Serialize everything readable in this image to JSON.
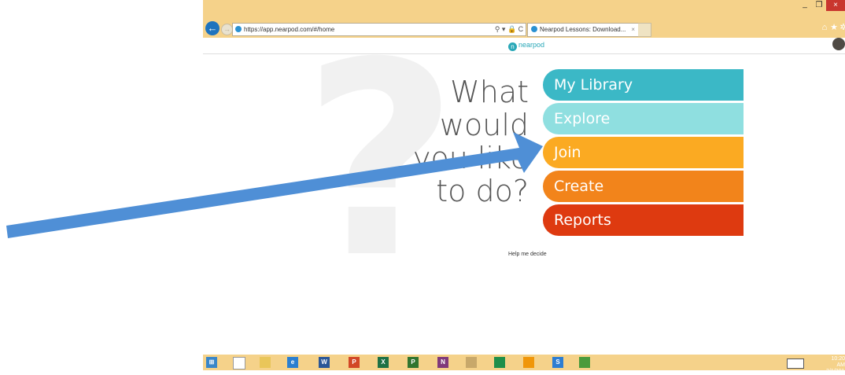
{
  "browser": {
    "url": "https://app.nearpod.com/#/home",
    "tab_title": "Nearpod Lessons: Download...",
    "tab_close": "×",
    "toolbar_glyphs": "⚲ ▾ 🔒 C",
    "back_icon": "arrow-left",
    "window": {
      "min": "_",
      "max": "❐",
      "close": "×"
    }
  },
  "site": {
    "logo_text": "nearpod"
  },
  "question": [
    "What",
    "would",
    "you like",
    "to do?"
  ],
  "menu": [
    {
      "label": "My Library",
      "color": "#3bb8c6"
    },
    {
      "label": "Explore",
      "color": "#8fdfe0"
    },
    {
      "label": "Join",
      "color": "#fbaa22"
    },
    {
      "label": "Create",
      "color": "#f2841b"
    },
    {
      "label": "Reports",
      "color": "#de3a10"
    }
  ],
  "help_link": "Help me decide",
  "annotation": {
    "color": "#4f8fd6"
  },
  "taskbar": {
    "apps": [
      {
        "name": "start",
        "color": "#3a86c8",
        "glyph": "⊞"
      },
      {
        "name": "file",
        "color": "#ffffff",
        "glyph": ""
      },
      {
        "name": "file-explorer",
        "color": "#e9c65a",
        "glyph": ""
      },
      {
        "name": "internet-explorer",
        "color": "#2b7fd0",
        "glyph": "e"
      },
      {
        "name": "word",
        "color": "#2b5797",
        "glyph": "W"
      },
      {
        "name": "powerpoint",
        "color": "#d24726",
        "glyph": "P"
      },
      {
        "name": "excel",
        "color": "#1e7145",
        "glyph": "X"
      },
      {
        "name": "project",
        "color": "#31752f",
        "glyph": "P"
      },
      {
        "name": "onenote",
        "color": "#80397b",
        "glyph": "N"
      },
      {
        "name": "paint",
        "color": "#c8a86a",
        "glyph": ""
      },
      {
        "name": "app-green",
        "color": "#1f8f4a",
        "glyph": ""
      },
      {
        "name": "store",
        "color": "#f09609",
        "glyph": ""
      },
      {
        "name": "sway",
        "color": "#2d7dd2",
        "glyph": "S"
      },
      {
        "name": "evernote",
        "color": "#4a9b3c",
        "glyph": ""
      }
    ],
    "time": "10:20 AM",
    "date": "3/1/2016"
  }
}
